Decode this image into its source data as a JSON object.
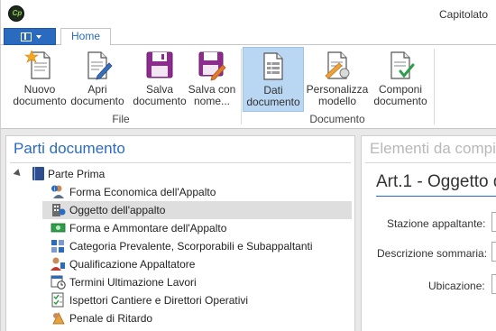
{
  "window": {
    "title": "Capitolato",
    "logo_text": "Cp"
  },
  "ribbon": {
    "tabs": [
      {
        "label": "Home",
        "active": true
      }
    ],
    "groups": [
      {
        "label": "File",
        "buttons": [
          {
            "label": "Nuovo documento",
            "icon": "new-document-icon"
          },
          {
            "label": "Apri documento",
            "icon": "open-document-icon"
          },
          {
            "label": "Salva documento",
            "icon": "save-icon"
          },
          {
            "label": "Salva con nome...",
            "icon": "save-as-icon"
          }
        ]
      },
      {
        "label": "Documento",
        "buttons": [
          {
            "label": "Dati documento",
            "icon": "document-data-icon",
            "active": true
          },
          {
            "label": "Personalizza modello",
            "icon": "customize-template-icon"
          },
          {
            "label": "Componi documento",
            "icon": "compose-document-icon"
          }
        ]
      }
    ]
  },
  "left_pane": {
    "title": "Parti documento",
    "root": {
      "label": "Parte Prima",
      "expanded": true
    },
    "items": [
      {
        "label": "Forma Economica dell'Appalto",
        "icon": "info-user-icon"
      },
      {
        "label": "Oggetto dell'appalto",
        "icon": "building-icon",
        "selected": true
      },
      {
        "label": "Forma e Ammontare dell'Appalto",
        "icon": "money-icon"
      },
      {
        "label": "Categoria Prevalente, Scorporabili e Subappaltanti",
        "icon": "categories-icon"
      },
      {
        "label": "Qualificazione Appaltatore",
        "icon": "person-badge-icon"
      },
      {
        "label": "Termini Ultimazione Lavori",
        "icon": "calendar-clock-icon"
      },
      {
        "label": "Ispettori Cantiere e Direttori Operativi",
        "icon": "checklist-icon"
      },
      {
        "label": "Penale di Ritardo",
        "icon": "penalty-icon"
      }
    ]
  },
  "right_pane": {
    "title": "Elementi da compi",
    "section_title": "Art.1 - Oggetto d",
    "fields": [
      {
        "label": "Stazione appaltante:",
        "value": ""
      },
      {
        "label": "Descrizione sommaria:",
        "value": ""
      },
      {
        "label": "Ubicazione:",
        "value": ""
      }
    ]
  },
  "colors": {
    "accent": "#2b6bbf",
    "ribbon_active": "#b9d6f2",
    "selection": "#dedede"
  }
}
